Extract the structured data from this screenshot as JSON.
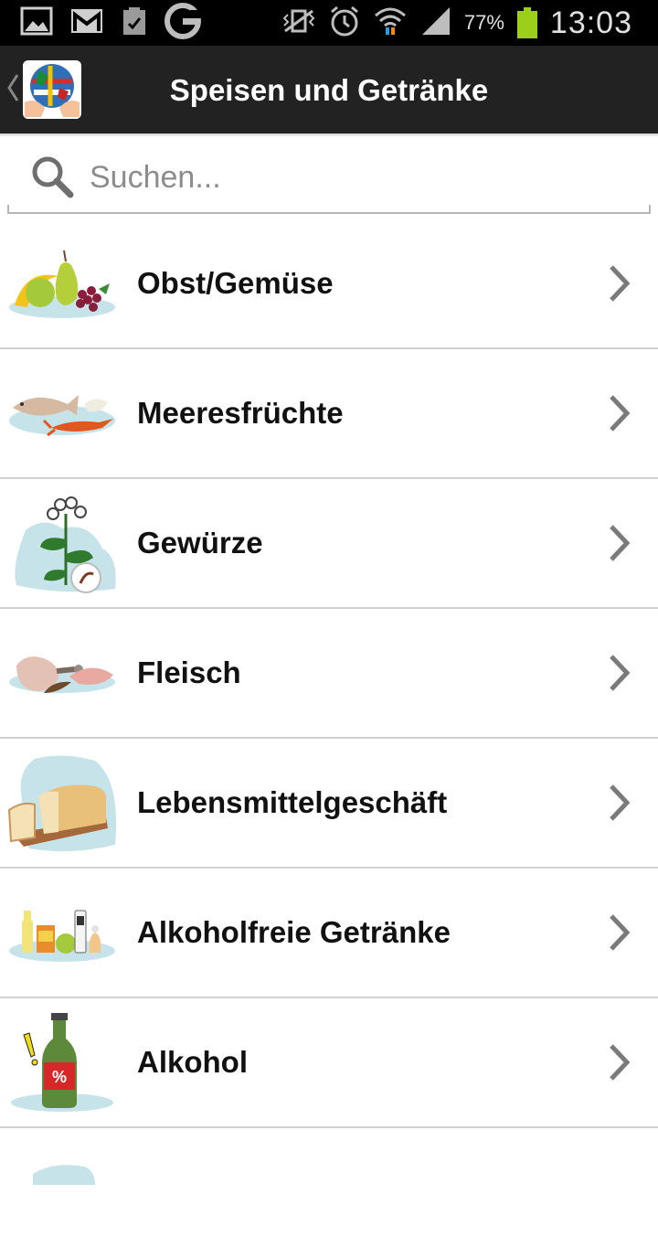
{
  "status_bar": {
    "battery": "77%",
    "time": "13:03",
    "icons": [
      "gallery-icon",
      "gmail-icon",
      "clipboard-icon",
      "google-icon",
      "vibrate-icon",
      "alarm-icon",
      "wifi-icon",
      "signal-icon",
      "battery-icon"
    ]
  },
  "header": {
    "title": "Speisen und Getränke",
    "logo": "globe-hands-logo"
  },
  "search": {
    "placeholder": "Suchen..."
  },
  "categories": [
    {
      "label": "Obst/Gemüse",
      "icon": "fruit-icon"
    },
    {
      "label": "Meeresfrüchte",
      "icon": "seafood-icon"
    },
    {
      "label": "Gewürze",
      "icon": "herb-icon"
    },
    {
      "label": "Fleisch",
      "icon": "meat-icon"
    },
    {
      "label": "Lebensmittelgeschäft",
      "icon": "bread-icon"
    },
    {
      "label": "Alkoholfreie Getränke",
      "icon": "drinks-icon"
    },
    {
      "label": "Alkohol",
      "icon": "bottle-icon"
    },
    {
      "label": "",
      "icon": "next-category-icon"
    }
  ],
  "colors": {
    "action_bar": "#222222",
    "battery": "#9ad01a",
    "splash": "#c6e3ea"
  }
}
